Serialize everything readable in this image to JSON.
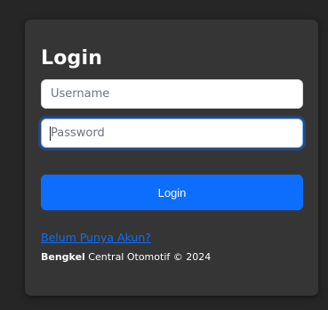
{
  "login": {
    "title": "Login",
    "username_placeholder": "Username",
    "password_placeholder": "Password",
    "submit_label": "Login",
    "register_link": "Belum Punya Akun?",
    "footer_brand": "Bengkel",
    "footer_text": " Central Otomotif © 2024"
  },
  "colors": {
    "background": "#262626",
    "card": "#353535",
    "primary": "#0d6efd",
    "focus_ring": "#86b7fe"
  }
}
